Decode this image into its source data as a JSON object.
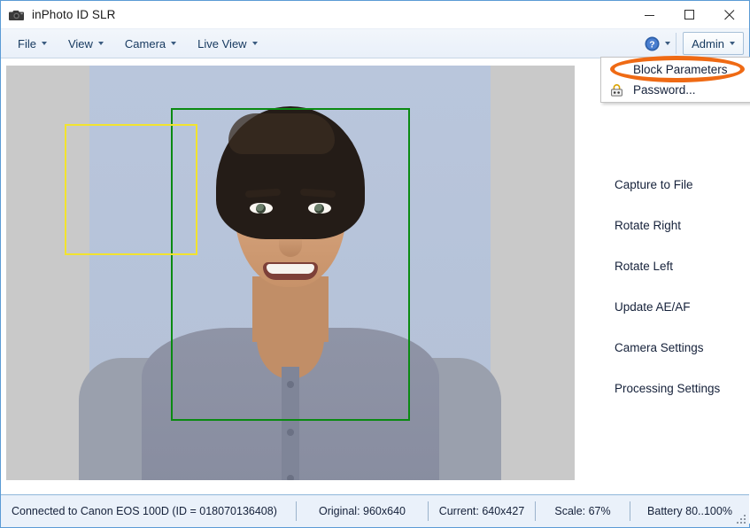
{
  "window": {
    "title": "inPhoto ID SLR",
    "icon": "camera-icon",
    "controls": {
      "minimize": "minimize-icon",
      "maximize": "maximize-icon",
      "close": "close-icon"
    }
  },
  "menubar": {
    "items": [
      {
        "label": "File"
      },
      {
        "label": "View"
      },
      {
        "label": "Camera"
      },
      {
        "label": "Live View"
      }
    ],
    "help": {
      "icon": "help-icon",
      "label": ""
    },
    "admin": {
      "label": "Admin"
    }
  },
  "admin_dropdown": {
    "open": true,
    "items": [
      {
        "label": "Block Parameters",
        "icon": "",
        "highlighted": true
      },
      {
        "label": "Password...",
        "icon": "lock-icon",
        "highlighted": false
      }
    ],
    "annotation_color": "#ef6a14"
  },
  "commands": [
    {
      "label": "Capture to File"
    },
    {
      "label": "Rotate Right"
    },
    {
      "label": "Rotate Left"
    },
    {
      "label": "Update AE/AF"
    },
    {
      "label": "Camera Settings"
    },
    {
      "label": "Processing Settings"
    }
  ],
  "preview": {
    "document_box_color": "#0a8a12",
    "face_box_color": "#f2e32e"
  },
  "statusbar": {
    "connected": "Connected to Canon EOS 100D (ID = 018070136408)",
    "original": "Original: 960x640",
    "current": "Current: 640x427",
    "scale": "Scale: 67%",
    "battery": "Battery 80..100%"
  }
}
